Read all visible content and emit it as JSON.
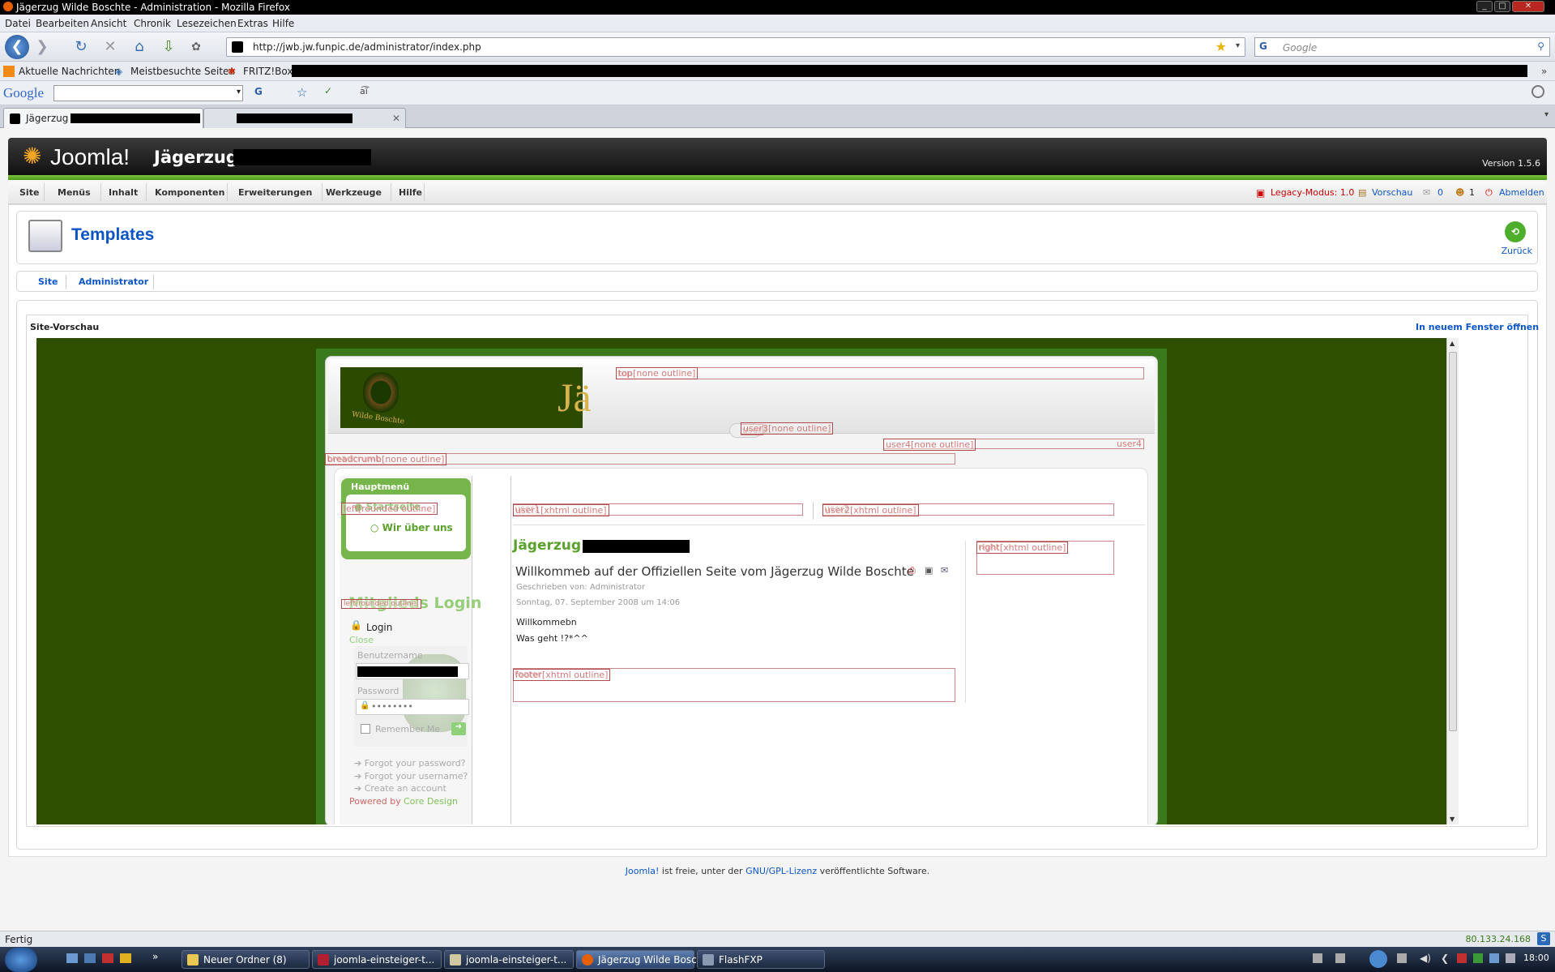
{
  "window": {
    "title": "Jägerzug Wilde Boschte - Administration - Mozilla Firefox"
  },
  "menubar": [
    "Datei",
    "Bearbeiten",
    "Ansicht",
    "Chronik",
    "Lesezeichen",
    "Extras",
    "Hilfe"
  ],
  "navbar": {
    "url": "http://jwb.jw.funpic.de/administrator/index.php",
    "search_placeholder": "Google"
  },
  "bookmarks": [
    "Aktuelle Nachrichten",
    "Meistbesuchte Seiten",
    "FRITZ!Box"
  ],
  "google_toolbar": {
    "logo": "Google"
  },
  "tabs": [
    {
      "label": "Jägerzug"
    }
  ],
  "joomla": {
    "logo": "Joomla!",
    "site_name": "Jägerzug",
    "version": "Version 1.5.6",
    "menu": [
      "Site",
      "Menüs",
      "Inhalt",
      "Komponenten",
      "Erweiterungen",
      "Werkzeuge",
      "Hilfe"
    ],
    "status": {
      "legacy": "Legacy-Modus: 1.0",
      "preview": "Vorschau",
      "messages": "0",
      "users": "1",
      "logout": "Abmelden"
    },
    "page_title": "Templates",
    "back": "Zurück",
    "submenu": [
      "Site",
      "Administrator"
    ],
    "preview_label": "Site-Vorschau",
    "open_new_window": "In neuem Fenster öffnen"
  },
  "preview": {
    "banner_text": "Jä",
    "banner_logo_text": "Wilde Boschte",
    "positions": {
      "top": "top",
      "top_outline": "top[none outline]",
      "user3": "user3",
      "user3_outline": "user3[none outline]",
      "user4": "user4",
      "user4_outline": "user4[none outline]",
      "breadcrumb": "breadcrumb",
      "breadcrumb_outline": "breadcrumb[none outline]",
      "left": "left[rounded outline]",
      "user1": "user1",
      "user1_outline": "user1[xhtml outline]",
      "user2": "user2",
      "user2_outline": "user2[xhtml outline]",
      "right": "right",
      "right_outline": "right[xhtml outline]",
      "footer": "footer",
      "footer_outline": "footer[xhtml outline]",
      "left_login": "left[rounded outline]"
    },
    "mainmenu": {
      "title": "Hauptmenü",
      "items": [
        "Startseite",
        "Wir über uns"
      ]
    },
    "login": {
      "title": "Mitglieds Login",
      "login_label": "Login",
      "close": "Close",
      "username_label": "Benutzername",
      "password_label": "Password",
      "password_value": "••••••••",
      "remember": "Remember Me",
      "links": [
        "Forgot your password?",
        "Forgot your username?",
        "Create an account"
      ],
      "powered_by": "Powered by",
      "powered_link": "Core Design"
    },
    "content": {
      "site_title": "Jägerzug",
      "article_title": "Willkommeb auf der Offiziellen Seite vom Jägerzug Wilde Boschte",
      "author": "Geschrieben von: Administrator",
      "date": "Sonntag, 07. September 2008 um 14:06",
      "body": [
        "Willkommebn",
        "Was geht !?*^^"
      ]
    }
  },
  "footer": {
    "joomla": "Joomla!",
    "text1": "ist freie, unter der",
    "license": "GNU/GPL-Lizenz",
    "text2": "veröffentlichte Software."
  },
  "statusbar": {
    "left": "Fertig",
    "ip": "80.133.24.168"
  },
  "taskbar": {
    "items": [
      "Neuer Ordner (8)",
      "joomla-einsteiger-t...",
      "joomla-einsteiger-t...",
      "Jägerzug Wilde Bosc...",
      "FlashFXP"
    ],
    "clock": "18:00"
  }
}
